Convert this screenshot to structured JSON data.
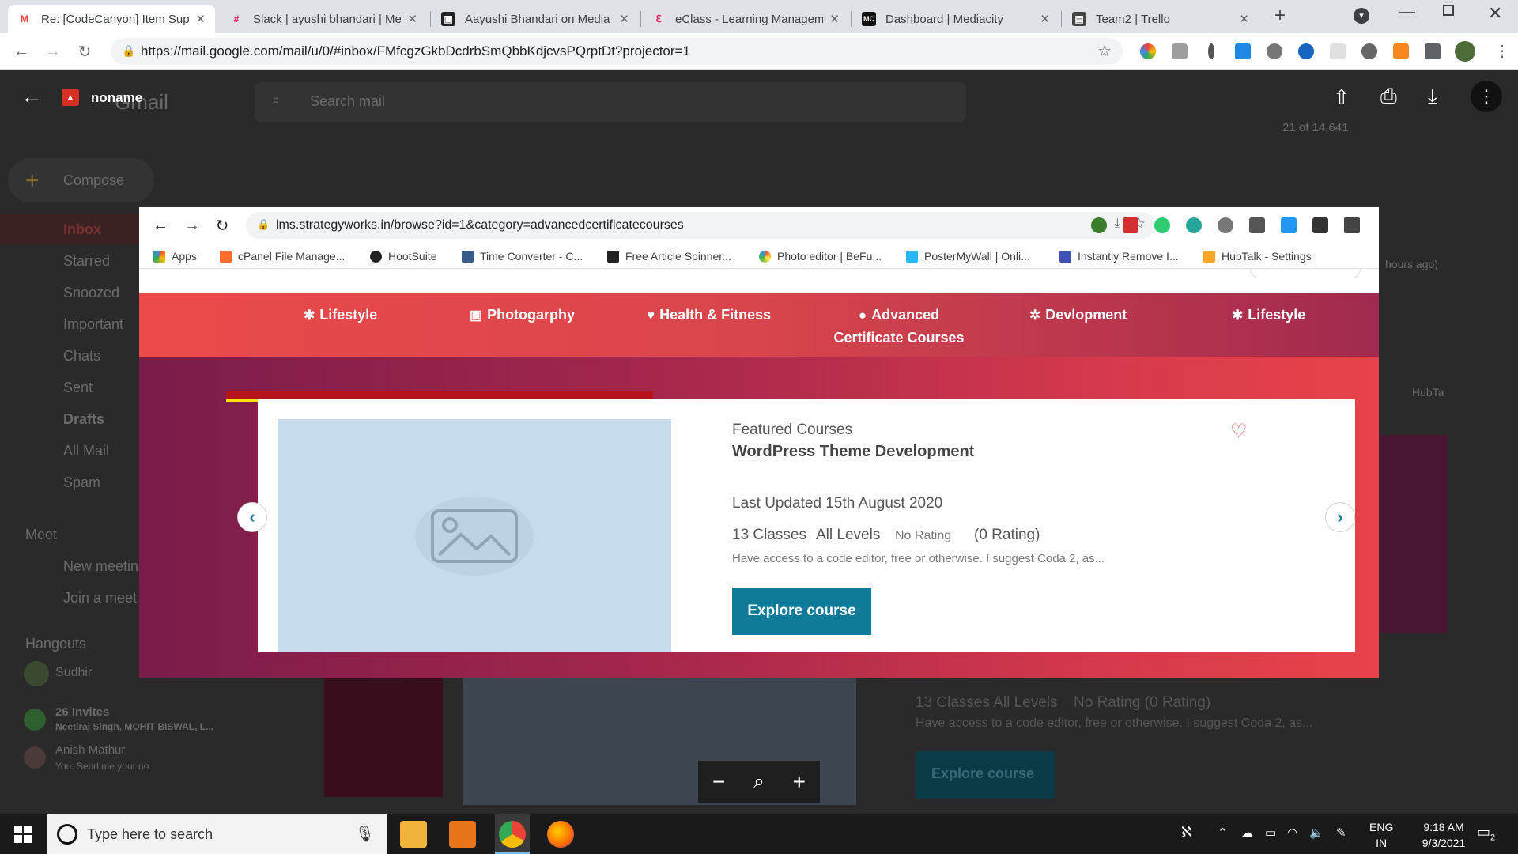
{
  "browser": {
    "tabs": [
      {
        "label": "Re: [CodeCanyon] Item Sup",
        "icon": "gmail-icon",
        "color": "#ea4335"
      },
      {
        "label": "Slack | ayushi bhandari | Me",
        "icon": "slack-icon",
        "color": "#e01e5a"
      },
      {
        "label": "Aayushi Bhandari on Media",
        "icon": "trello-icon",
        "color": "#222222"
      },
      {
        "label": "eClass - Learning Managem",
        "icon": "eclass-icon",
        "color": "#e0245e"
      },
      {
        "label": "Dashboard | Mediacity",
        "icon": "mediacity-icon",
        "color": "#111111"
      },
      {
        "label": "Team2 | Trello",
        "icon": "trello-board-icon",
        "color": "#444444"
      }
    ],
    "url": "https://mail.google.com/mail/u/0/#inbox/FMfcgzGkbDcdrbSmQbbKdjcvsPQrptDt?projector=1"
  },
  "gmail": {
    "logo": "Gmail",
    "search_placeholder": "Search mail",
    "compose": "Compose",
    "count": "21 of 14,641",
    "sidebar": [
      "Inbox",
      "Starred",
      "Snoozed",
      "Important",
      "Chats",
      "Sent",
      "Drafts",
      "All Mail",
      "Spam"
    ],
    "meet_header": "Meet",
    "meet_items": [
      "New meetin",
      "Join a meet"
    ],
    "hangouts_header": "Hangouts",
    "hangouts_user": "Sudhir",
    "invites_title": "26 Invites",
    "invites_sub": "Neetiraj Singh, MOHIT BISWAL, L...",
    "chat_name": "Anish Mathur",
    "chat_msg": "You: Send me your no",
    "right_peek": "hours ago)",
    "right_peek2": "HubTa",
    "bg_classes": "13 Classes  All Levels",
    "bg_rating": "No Rating  (0 Rating)",
    "bg_desc": "Have access to a code editor, free or otherwise. I suggest Coda 2, as...",
    "bg_explore": "Explore course"
  },
  "viewer": {
    "title": "noname"
  },
  "screenshot": {
    "url": "lms.strategyworks.in/browse?id=1&category=advancedcertificatecourses",
    "bookmarks": [
      "Apps",
      "cPanel File Manage...",
      "HootSuite",
      "Time Converter - C...",
      "Free Article Spinner...",
      "Photo editor | BeFu...",
      "PosterMyWall | Onli...",
      "Instantly Remove I...",
      "HubTalk - Settings"
    ],
    "menu": [
      "Lifestyle",
      "Photogarphy",
      "Health & Fitness",
      "Advanced",
      "Certificate Courses",
      "Devlopment",
      "Lifestyle"
    ],
    "card": {
      "kicker": "Featured Courses",
      "title": "WordPress Theme Development",
      "updated": "Last Updated 15th August 2020",
      "classes": "13 Classes",
      "level": "All Levels",
      "rating": "No Rating",
      "rating_count": "(0 Rating)",
      "desc": "Have access to a code editor, free or otherwise. I suggest Coda 2, as...",
      "button": "Explore course"
    }
  },
  "taskbar": {
    "search": "Type here to search",
    "lang1": "ENG",
    "lang2": "IN",
    "time": "9:18 AM",
    "date": "9/3/2021",
    "notif": "2"
  }
}
